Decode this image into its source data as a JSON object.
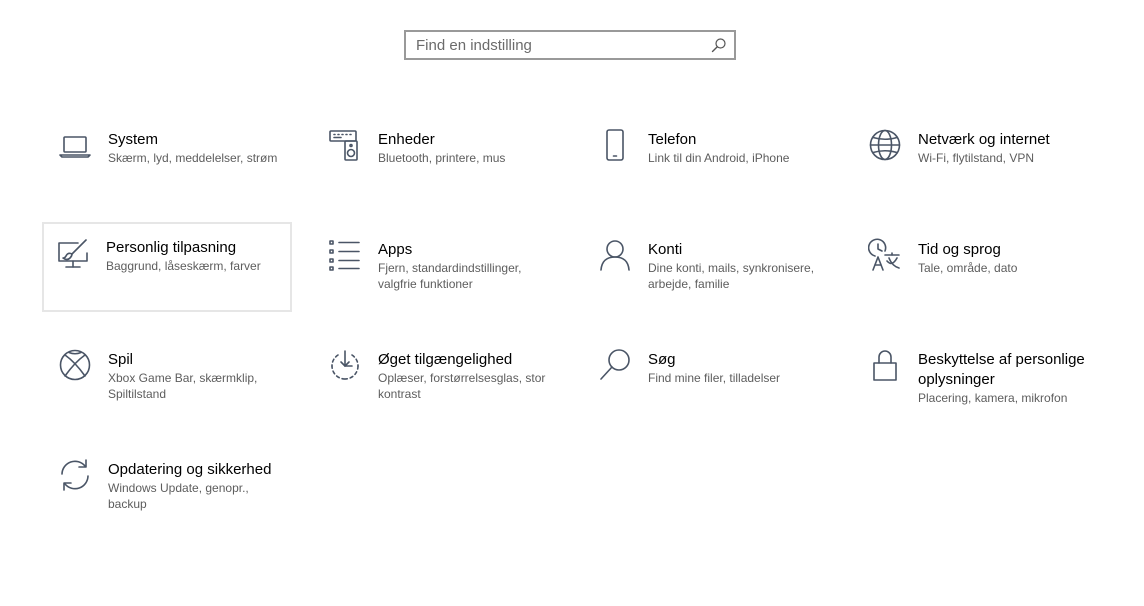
{
  "search": {
    "placeholder": "Find en indstilling",
    "icon": "search-icon"
  },
  "colors": {
    "icon": "#4a5566",
    "title": "#000000",
    "description": "#5d5d5d",
    "search_border": "#999999",
    "hover_border": "#e6e6e6"
  },
  "categories": [
    {
      "id": "system",
      "title": "System",
      "desc": "Skærm, lyd, meddelelser, strøm",
      "icon": "laptop-icon"
    },
    {
      "id": "devices",
      "title": "Enheder",
      "desc": "Bluetooth, printere, mus",
      "icon": "keyboard-speaker-icon"
    },
    {
      "id": "phone",
      "title": "Telefon",
      "desc": "Link til din Android, iPhone",
      "icon": "phone-icon"
    },
    {
      "id": "network",
      "title": "Netværk og internet",
      "desc": "Wi-Fi, flytilstand, VPN",
      "icon": "globe-icon"
    },
    {
      "id": "personalization",
      "title": "Personlig tilpasning",
      "desc": "Baggrund, låseskærm, farver",
      "icon": "paintbrush-monitor-icon"
    },
    {
      "id": "apps",
      "title": "Apps",
      "desc": "Fjern, standardindstillinger, valgfrie funktioner",
      "icon": "list-icon"
    },
    {
      "id": "accounts",
      "title": "Konti",
      "desc": "Dine konti, mails, synkronisere, arbejde, familie",
      "icon": "person-icon"
    },
    {
      "id": "time-language",
      "title": "Tid og sprog",
      "desc": "Tale, område, dato",
      "icon": "clock-language-icon"
    },
    {
      "id": "gaming",
      "title": "Spil",
      "desc": "Xbox Game Bar, skærmklip, Spiltilstand",
      "icon": "xbox-icon"
    },
    {
      "id": "ease-of-access",
      "title": "Øget tilgængelighed",
      "desc": "Oplæser, forstørrelsesglas, stor kontrast",
      "icon": "ease-of-access-icon"
    },
    {
      "id": "search-cat",
      "title": "Søg",
      "desc": "Find mine filer, tilladelser",
      "icon": "magnifier-icon"
    },
    {
      "id": "privacy",
      "title": "Beskyttelse af personlige oplysninger",
      "desc": "Placering, kamera, mikrofon",
      "icon": "lock-icon"
    },
    {
      "id": "update",
      "title": "Opdatering og sikkerhed",
      "desc": "Windows Update, genopr., backup",
      "icon": "sync-icon"
    }
  ]
}
